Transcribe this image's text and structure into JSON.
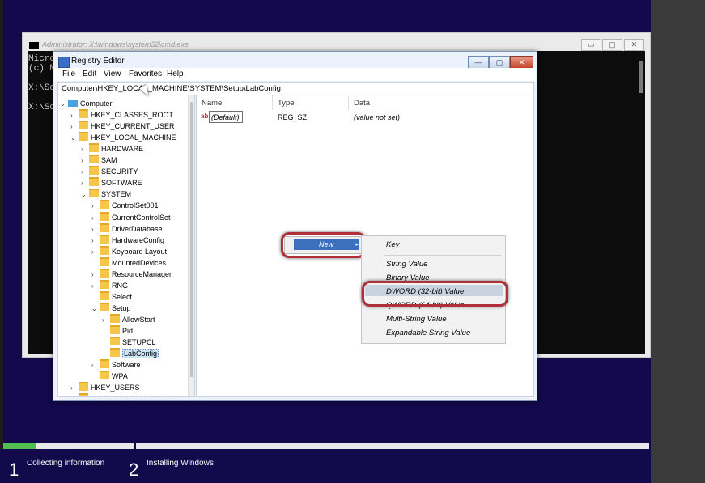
{
  "setup": {
    "step1_num": "1",
    "step1_label": "Collecting information",
    "step2_num": "2",
    "step2_label": "Installing Windows",
    "progress_fraction": 0.05,
    "colors": {
      "background": "#14094c",
      "progress_fill": "#4fbf52",
      "highlight_ring": "#b0303a"
    }
  },
  "cmd": {
    "title": "Administrator: X:\\windows\\system32\\cmd.exe",
    "lines": [
      "Micro",
      "(c) M",
      "",
      "X:\\So",
      "",
      "X:\\So"
    ],
    "min_icon": "minimize-icon",
    "max_icon": "maximize-icon",
    "close_icon": "close-icon",
    "min_glyph": "▭",
    "max_glyph": "▢",
    "close_glyph": "✕"
  },
  "regedit": {
    "title": "Registry Editor",
    "min_glyph": "—",
    "max_glyph": "▢",
    "close_glyph": "✕",
    "menu": [
      "File",
      "Edit",
      "View",
      "Favorites",
      "Help"
    ],
    "address": "Computer\\HKEY_LOCAL_MACHINE\\SYSTEM\\Setup\\LabConfig",
    "tree": [
      {
        "label": "Computer",
        "level": 0,
        "chev": "⌄",
        "icon": "computer-icon"
      },
      {
        "label": "HKEY_CLASSES_ROOT",
        "level": 1,
        "chev": "›"
      },
      {
        "label": "HKEY_CURRENT_USER",
        "level": 1,
        "chev": "›"
      },
      {
        "label": "HKEY_LOCAL_MACHINE",
        "level": 1,
        "chev": "⌄"
      },
      {
        "label": "HARDWARE",
        "level": 2,
        "chev": "›"
      },
      {
        "label": "SAM",
        "level": 2,
        "chev": "›"
      },
      {
        "label": "SECURITY",
        "level": 2,
        "chev": "›"
      },
      {
        "label": "SOFTWARE",
        "level": 2,
        "chev": "›"
      },
      {
        "label": "SYSTEM",
        "level": 2,
        "chev": "⌄"
      },
      {
        "label": "ControlSet001",
        "level": 3,
        "chev": "›"
      },
      {
        "label": "CurrentControlSet",
        "level": 3,
        "chev": "›"
      },
      {
        "label": "DriverDatabase",
        "level": 3,
        "chev": "›"
      },
      {
        "label": "HardwareConfig",
        "level": 3,
        "chev": "›"
      },
      {
        "label": "Keyboard Layout",
        "level": 3,
        "chev": "›"
      },
      {
        "label": "MountedDevices",
        "level": 3,
        "chev": ""
      },
      {
        "label": "ResourceManager",
        "level": 3,
        "chev": "›"
      },
      {
        "label": "RNG",
        "level": 3,
        "chev": "›"
      },
      {
        "label": "Select",
        "level": 3,
        "chev": ""
      },
      {
        "label": "Setup",
        "level": 3,
        "chev": "⌄"
      },
      {
        "label": "AllowStart",
        "level": 4,
        "chev": "›"
      },
      {
        "label": "Pid",
        "level": 4,
        "chev": ""
      },
      {
        "label": "SETUPCL",
        "level": 4,
        "chev": ""
      },
      {
        "label": "LabConfig",
        "level": 4,
        "chev": "",
        "selected": true
      },
      {
        "label": "Software",
        "level": 3,
        "chev": "›"
      },
      {
        "label": "WPA",
        "level": 3,
        "chev": ""
      },
      {
        "label": "HKEY_USERS",
        "level": 1,
        "chev": "›"
      },
      {
        "label": "HKEY_CURRENT_CONFIG",
        "level": 1,
        "chev": "›"
      }
    ],
    "columns": [
      "Name",
      "Type",
      "Data"
    ],
    "values": [
      {
        "name": "(Default)",
        "type": "REG_SZ",
        "data": "(value not set)",
        "icon_text": "ab"
      }
    ]
  },
  "context_menu": {
    "new_label": "New",
    "new_arrow": "▸",
    "submenu": [
      "Key",
      "String Value",
      "Binary Value",
      "DWORD (32-bit) Value",
      "QWORD (64-bit) Value",
      "Multi-String Value",
      "Expandable String Value"
    ],
    "highlighted": "DWORD (32-bit) Value"
  }
}
